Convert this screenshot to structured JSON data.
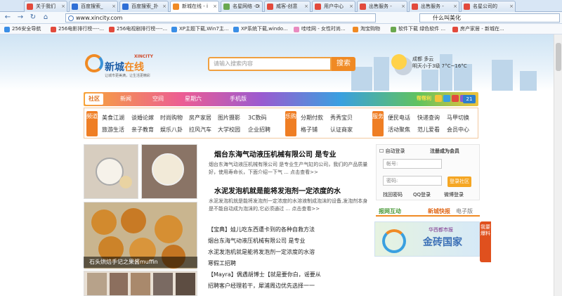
{
  "tabs": [
    {
      "label": "关于我们",
      "color": "#e24a3c"
    },
    {
      "label": "百度搜索_",
      "color": "#2f6fd6"
    },
    {
      "label": "百度搜索_扑",
      "color": "#2f6fd6"
    },
    {
      "label": "新城在线 - i",
      "color": "#f08a24"
    },
    {
      "label": "名星网络 -D",
      "color": "#6aa84f"
    },
    {
      "label": "威客-创意",
      "color": "#e24a3c"
    },
    {
      "label": "用户中心",
      "color": "#e24a3c"
    },
    {
      "label": "出售服务 -",
      "color": "#e24a3c"
    },
    {
      "label": "出售服务 -",
      "color": "#e24a3c"
    },
    {
      "label": "名星公司的",
      "color": "#e24a3c"
    }
  ],
  "tab_close": "×",
  "nav": {
    "back": "←",
    "forward": "→",
    "reload": "↻",
    "home": "⌂",
    "url": "www.xincity.com",
    "search": "什么叫美化"
  },
  "bookmarks": [
    "256安全导航",
    "256电影排行榜----...",
    "256电视剧排行榜----...",
    "XP主题下载,Win7主...",
    "XP系统下载,windo...",
    "哇哇网 - 女性时尚...",
    "淘宝购物",
    "软件下载 绿色软件 ...",
    "房产家居 - 新城在..."
  ],
  "site": {
    "logo_cn": "新城",
    "logo_cn2": "在线",
    "logo_en": "XINCITY",
    "slogan": "让城市更美满，让生活更精彩",
    "search_placeholder": "请输入搜索内容",
    "search_btn": "搜索",
    "weather_city": "成都 多云",
    "weather_detail": "明天小于3级 7°C~16°C"
  },
  "channels": {
    "home": "社区",
    "items": [
      "新闻",
      "空间",
      "星期六",
      "手机版"
    ],
    "hot": "帮帮利",
    "num": "21"
  },
  "sub": {
    "c1": "频道",
    "c2": "乐购",
    "c3": "服务",
    "row1": [
      "美食江湖",
      "谈婚论嫁",
      "时尚购物",
      "房产家居",
      "图片摄影",
      "3C数码"
    ],
    "row2": [
      "旅游生活",
      "亲子教育",
      "娱乐八卦",
      "拉风汽车",
      "大学校园",
      "企业招聘"
    ],
    "row1b": [
      "分期付款",
      "秀秀宝贝"
    ],
    "row2b": [
      "格子铺",
      "认证商家"
    ],
    "row1c": [
      "便民电话",
      "快递查询",
      "马甲切换"
    ],
    "row2c": [
      "活动聚焦",
      "范儿爱看",
      "会员中心"
    ]
  },
  "pic_caption": "石头烘焙手记之果酱muffin",
  "news": {
    "h1": "烟台东海气动液压机械有限公司 是专业",
    "p1": "烟台东海气动液压机械有限公司 是专业生产气缸的公司，我们的产品质量好，使用寿命长，下面介绍一下气 ... 点击查看>>",
    "h2": "水泥发泡机就是能将发泡剂一定浓度的水",
    "p2": "水泥发泡机就是能将发泡剂一定浓度的水溶液制成泡沫的设备,发泡剂本身是不能自动成为泡沫的,它必须通过 ... 点击查看>>",
    "lines": [
      "【宝典】娃儿吃东西遭卡到的各种自救方法",
      "烟台东海气动液压机械有限公司 是专业",
      "水泥发泡机就是能将发泡剂一定浓度的水溶",
      "寒假工招聘",
      "【Mayra】偶遇胡博士【就是要你白，谣要从",
      "招聘客户经理若干，犀浦周边优先选择一一"
    ]
  },
  "login": {
    "auto": "自动登录",
    "reg": "注册成为会员",
    "user": "帐号:",
    "pass": "密码:",
    "btn": "登录社区",
    "forgot": "找回密码",
    "qq": "QQ登录",
    "weibo": "微博登录"
  },
  "tabs2": {
    "a": "报网互动",
    "b": "新城快报",
    "c": "电子版"
  },
  "banner": {
    "t1": "华西都市报",
    "t2": "金砖国家"
  },
  "side": "我要爆料"
}
